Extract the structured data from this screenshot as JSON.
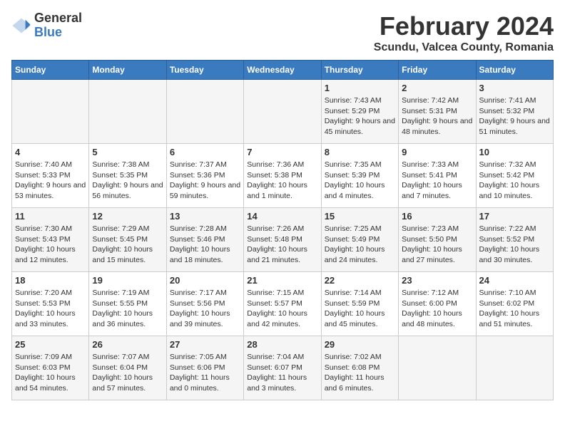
{
  "header": {
    "logo_general": "General",
    "logo_blue": "Blue",
    "title": "February 2024",
    "location": "Scundu, Valcea County, Romania"
  },
  "calendar": {
    "days_of_week": [
      "Sunday",
      "Monday",
      "Tuesday",
      "Wednesday",
      "Thursday",
      "Friday",
      "Saturday"
    ],
    "weeks": [
      [
        {
          "day": "",
          "info": ""
        },
        {
          "day": "",
          "info": ""
        },
        {
          "day": "",
          "info": ""
        },
        {
          "day": "",
          "info": ""
        },
        {
          "day": "1",
          "info": "Sunrise: 7:43 AM\nSunset: 5:29 PM\nDaylight: 9 hours and 45 minutes."
        },
        {
          "day": "2",
          "info": "Sunrise: 7:42 AM\nSunset: 5:31 PM\nDaylight: 9 hours and 48 minutes."
        },
        {
          "day": "3",
          "info": "Sunrise: 7:41 AM\nSunset: 5:32 PM\nDaylight: 9 hours and 51 minutes."
        }
      ],
      [
        {
          "day": "4",
          "info": "Sunrise: 7:40 AM\nSunset: 5:33 PM\nDaylight: 9 hours and 53 minutes."
        },
        {
          "day": "5",
          "info": "Sunrise: 7:38 AM\nSunset: 5:35 PM\nDaylight: 9 hours and 56 minutes."
        },
        {
          "day": "6",
          "info": "Sunrise: 7:37 AM\nSunset: 5:36 PM\nDaylight: 9 hours and 59 minutes."
        },
        {
          "day": "7",
          "info": "Sunrise: 7:36 AM\nSunset: 5:38 PM\nDaylight: 10 hours and 1 minute."
        },
        {
          "day": "8",
          "info": "Sunrise: 7:35 AM\nSunset: 5:39 PM\nDaylight: 10 hours and 4 minutes."
        },
        {
          "day": "9",
          "info": "Sunrise: 7:33 AM\nSunset: 5:41 PM\nDaylight: 10 hours and 7 minutes."
        },
        {
          "day": "10",
          "info": "Sunrise: 7:32 AM\nSunset: 5:42 PM\nDaylight: 10 hours and 10 minutes."
        }
      ],
      [
        {
          "day": "11",
          "info": "Sunrise: 7:30 AM\nSunset: 5:43 PM\nDaylight: 10 hours and 12 minutes."
        },
        {
          "day": "12",
          "info": "Sunrise: 7:29 AM\nSunset: 5:45 PM\nDaylight: 10 hours and 15 minutes."
        },
        {
          "day": "13",
          "info": "Sunrise: 7:28 AM\nSunset: 5:46 PM\nDaylight: 10 hours and 18 minutes."
        },
        {
          "day": "14",
          "info": "Sunrise: 7:26 AM\nSunset: 5:48 PM\nDaylight: 10 hours and 21 minutes."
        },
        {
          "day": "15",
          "info": "Sunrise: 7:25 AM\nSunset: 5:49 PM\nDaylight: 10 hours and 24 minutes."
        },
        {
          "day": "16",
          "info": "Sunrise: 7:23 AM\nSunset: 5:50 PM\nDaylight: 10 hours and 27 minutes."
        },
        {
          "day": "17",
          "info": "Sunrise: 7:22 AM\nSunset: 5:52 PM\nDaylight: 10 hours and 30 minutes."
        }
      ],
      [
        {
          "day": "18",
          "info": "Sunrise: 7:20 AM\nSunset: 5:53 PM\nDaylight: 10 hours and 33 minutes."
        },
        {
          "day": "19",
          "info": "Sunrise: 7:19 AM\nSunset: 5:55 PM\nDaylight: 10 hours and 36 minutes."
        },
        {
          "day": "20",
          "info": "Sunrise: 7:17 AM\nSunset: 5:56 PM\nDaylight: 10 hours and 39 minutes."
        },
        {
          "day": "21",
          "info": "Sunrise: 7:15 AM\nSunset: 5:57 PM\nDaylight: 10 hours and 42 minutes."
        },
        {
          "day": "22",
          "info": "Sunrise: 7:14 AM\nSunset: 5:59 PM\nDaylight: 10 hours and 45 minutes."
        },
        {
          "day": "23",
          "info": "Sunrise: 7:12 AM\nSunset: 6:00 PM\nDaylight: 10 hours and 48 minutes."
        },
        {
          "day": "24",
          "info": "Sunrise: 7:10 AM\nSunset: 6:02 PM\nDaylight: 10 hours and 51 minutes."
        }
      ],
      [
        {
          "day": "25",
          "info": "Sunrise: 7:09 AM\nSunset: 6:03 PM\nDaylight: 10 hours and 54 minutes."
        },
        {
          "day": "26",
          "info": "Sunrise: 7:07 AM\nSunset: 6:04 PM\nDaylight: 10 hours and 57 minutes."
        },
        {
          "day": "27",
          "info": "Sunrise: 7:05 AM\nSunset: 6:06 PM\nDaylight: 11 hours and 0 minutes."
        },
        {
          "day": "28",
          "info": "Sunrise: 7:04 AM\nSunset: 6:07 PM\nDaylight: 11 hours and 3 minutes."
        },
        {
          "day": "29",
          "info": "Sunrise: 7:02 AM\nSunset: 6:08 PM\nDaylight: 11 hours and 6 minutes."
        },
        {
          "day": "",
          "info": ""
        },
        {
          "day": "",
          "info": ""
        }
      ]
    ]
  }
}
